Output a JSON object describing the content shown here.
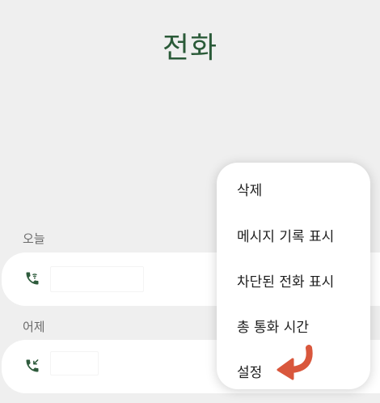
{
  "header": {
    "title": "전화"
  },
  "sections": {
    "today_label": "오늘",
    "yesterday_label": "어제"
  },
  "colors": {
    "title": "#2a5a38",
    "icon": "#2e5b3c",
    "annotation_arrow": "#d9573c"
  },
  "calls": [
    {
      "section": "today",
      "type_icon": "wifi-call-icon"
    },
    {
      "section": "yesterday",
      "type_icon": "incoming-call-icon"
    }
  ],
  "menu": {
    "items": [
      {
        "label": "삭제"
      },
      {
        "label": "메시지 기록 표시"
      },
      {
        "label": "차단된 전화 표시"
      },
      {
        "label": "총 통화 시간"
      },
      {
        "label": "설정"
      }
    ]
  },
  "annotation": {
    "icon": "curved-arrow-left-icon",
    "target": "설정"
  }
}
